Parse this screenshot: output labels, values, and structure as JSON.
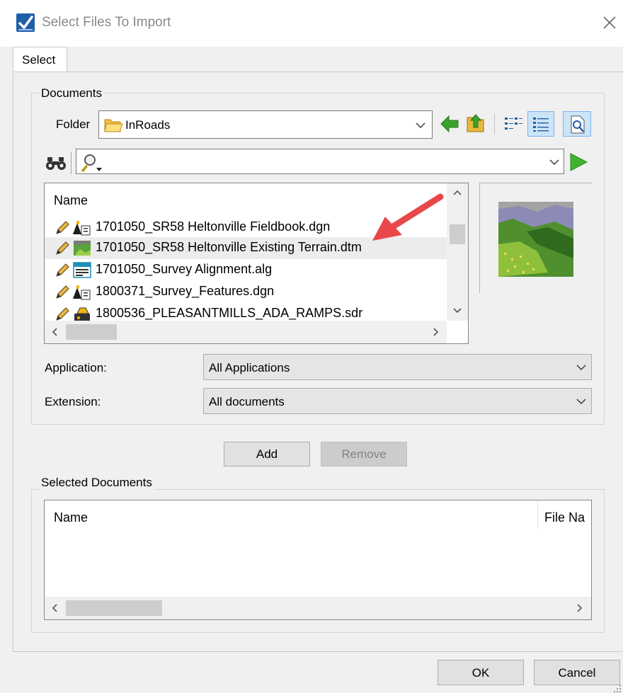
{
  "window": {
    "title": "Select Files To Import"
  },
  "tabs": [
    {
      "label": "Select"
    }
  ],
  "documents": {
    "group_label": "Documents",
    "folder_label": "Folder",
    "folder_value": "InRoads",
    "list_header": "Name",
    "files": [
      {
        "name": "1701050_SR58 Heltonville  Fieldbook.dgn",
        "icon": "dgn-file-icon"
      },
      {
        "name": "1701050_SR58 Heltonville Existing Terrain.dtm",
        "icon": "terrain-file-icon"
      },
      {
        "name": "1701050_Survey Alignment.alg",
        "icon": "cogo-file-icon"
      },
      {
        "name": "1800371_Survey_Features.dgn",
        "icon": "dgn-file-icon"
      },
      {
        "name": "1800536_PLEASANTMILLS_ADA_RAMPS.sdr",
        "icon": "survey-file-icon"
      }
    ],
    "selected_index": 1,
    "application_label": "Application:",
    "application_value": "All Applications",
    "extension_label": "Extension:",
    "extension_value": "All documents"
  },
  "actions": {
    "add_label": "Add",
    "remove_label": "Remove"
  },
  "selected_documents": {
    "group_label": "Selected Documents",
    "columns": [
      "Name",
      "File Na"
    ]
  },
  "footer": {
    "ok_label": "OK",
    "cancel_label": "Cancel"
  },
  "colors": {
    "accent_arrow": "#e8484a",
    "nav_green": "#3aa32e"
  }
}
